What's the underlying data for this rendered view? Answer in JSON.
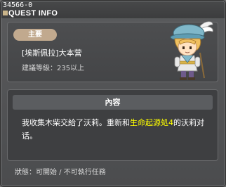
{
  "window": {
    "quest_id": "34566-0",
    "title": "QUEST INFO"
  },
  "quest": {
    "category": "主要",
    "name": "[埃斯佩拉]大本营",
    "level_requirement": "建議等級：235以上"
  },
  "content": {
    "header": "內容",
    "text_before": "我收集木柴交給了沃莉。重新和",
    "text_highlight": "生命起源処4",
    "text_after": "的沃莉对话。",
    "highlight_color": "#ffff00"
  },
  "footer": {
    "status": "狀態：可開始 / 不可執行任務"
  },
  "npc": {
    "icon": "npc-portrait"
  }
}
